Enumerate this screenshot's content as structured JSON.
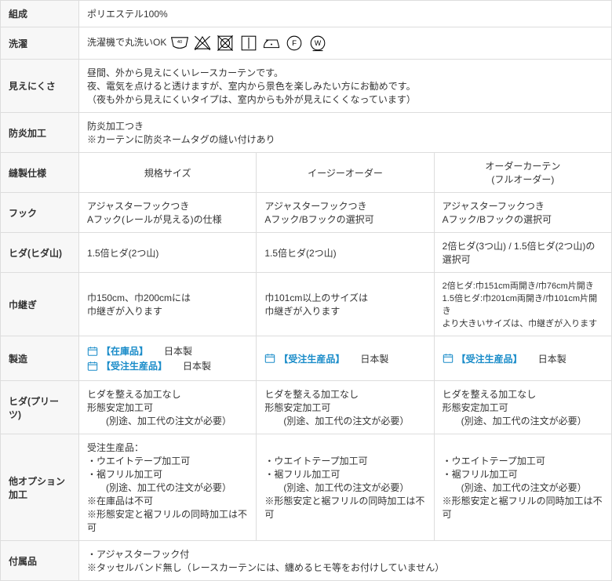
{
  "rows": {
    "composition": {
      "label": "組成",
      "value": "ポリエステル100%"
    },
    "wash": {
      "label": "洗濯",
      "text": "洗濯機で丸洗いOK"
    },
    "visibility": {
      "label": "見えにくさ",
      "l1": "昼間、外から見えにくいレースカーテンです。",
      "l2": "夜、電気を点けると透けますが、室内から景色を楽しみたい方にお勧めです。",
      "l3": "（夜も外から見えにくいタイプは、室内からも外が見えにくくなっています）"
    },
    "flame": {
      "label": "防炎加工",
      "l1": "防炎加工つき",
      "l2": "※カーテンに防炎ネームタグの縫い付けあり"
    },
    "sewing": {
      "label": "縫製仕様",
      "c1": "規格サイズ",
      "c2": "イージーオーダー",
      "c3": "オーダーカーテン\n(フルオーダー)"
    },
    "hook": {
      "label": "フック",
      "c1": "アジャスターフックつき\nAフック(レールが見える)の仕様",
      "c2": "アジャスターフックつき\nAフック/Bフックの選択可",
      "c3": "アジャスターフックつき\nAフック/Bフックの選択可"
    },
    "hida": {
      "label": "ヒダ(ヒダ山)",
      "c1": "1.5倍ヒダ(2つ山)",
      "c2": "1.5倍ヒダ(2つ山)",
      "c3": "2倍ヒダ(3つ山) / 1.5倍ヒダ(2つ山)の選択可"
    },
    "seam": {
      "label": "巾継ぎ",
      "c1": "巾150cm、巾200cmには\n巾継ぎが入ります",
      "c2": "巾101cm以上のサイズは\n巾継ぎが入ります",
      "c3": "2倍ヒダ:巾151cm両開き/巾76cm片開き\n1.5倍ヒダ:巾201cm両開き/巾101cm片開き\nより大きいサイズは、巾継ぎが入ります"
    },
    "mfg": {
      "label": "製造",
      "c1": [
        {
          "tag": "【在庫品】",
          "jp": "日本製"
        },
        {
          "tag": "【受注生産品】",
          "jp": "日本製"
        }
      ],
      "c2": [
        {
          "tag": "【受注生産品】",
          "jp": "日本製"
        }
      ],
      "c3": [
        {
          "tag": "【受注生産品】",
          "jp": "日本製"
        }
      ]
    },
    "pleats": {
      "label": "ヒダ(プリーツ)",
      "c1": "ヒダを整える加工なし\n形態安定加工可\n　　(別途、加工代の注文が必要）",
      "c2": "ヒダを整える加工なし\n形態安定加工可\n　　(別途、加工代の注文が必要）",
      "c3": "ヒダを整える加工なし\n形態安定加工可\n　　(別途、加工代の注文が必要）"
    },
    "options": {
      "label": "他オプション加工",
      "c1": "受注生産品：\n・ウエイトテープ加工可\n・裾フリル加工可\n　　(別途、加工代の注文が必要）\n※在庫品は不可\n※形態安定と裾フリルの同時加工は不可",
      "c2": "・ウエイトテープ加工可\n・裾フリル加工可\n　　(別途、加工代の注文が必要）\n※形態安定と裾フリルの同時加工は不可",
      "c3": "・ウエイトテープ加工可\n・裾フリル加工可\n　　(別途、加工代の注文が必要）\n※形態安定と裾フリルの同時加工は不可"
    },
    "accessories": {
      "label": "付属品",
      "l1": "・アジャスターフック付",
      "l2": "※タッセルバンド無し（レースカーテンには、纏めるヒモ等をお付けしていません）"
    }
  }
}
